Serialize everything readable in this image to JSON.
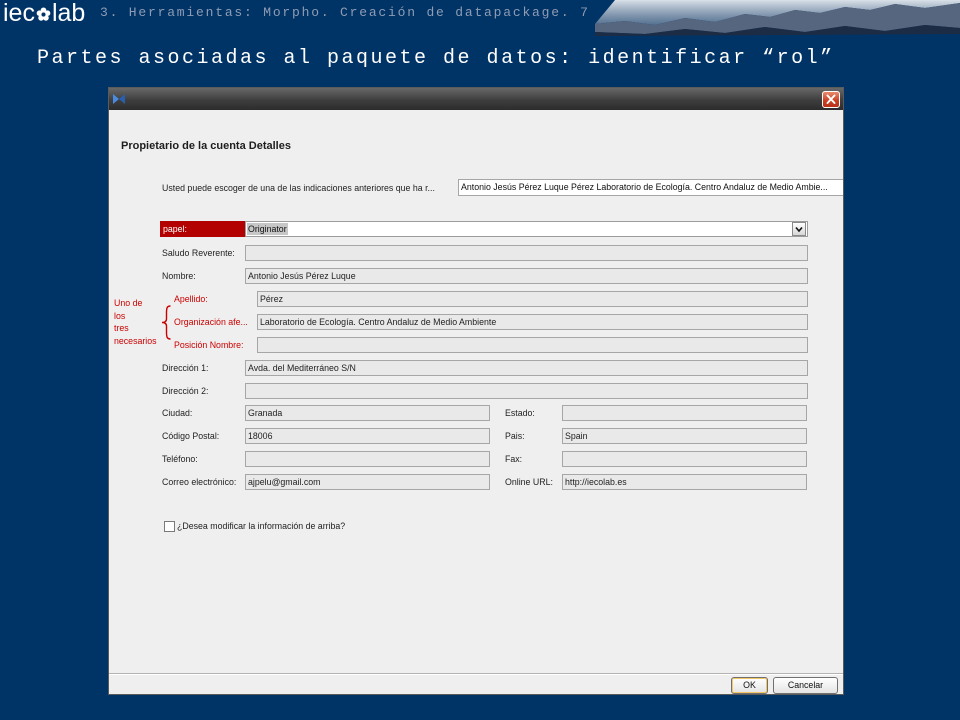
{
  "header": {
    "logo": {
      "part1": "iec",
      "part2": "lab"
    },
    "breadcrumb": "3. Herramientas: Morpho. Creación de datapackage. 7"
  },
  "slide": {
    "title": "Partes asociadas al paquete de datos: identificar “rol”"
  },
  "annotation": {
    "lines": [
      "Uno de",
      "los",
      "tres",
      "necesarios"
    ]
  },
  "dialog": {
    "section_title": "Propietario de la cuenta Detalles",
    "previous_choice": {
      "label": "Usted puede escoger de una de las indicaciones anteriores que ha r...",
      "value": "Antonio Jesús Pérez Luque Pérez Laboratorio de Ecología. Centro Andaluz de Medio Ambie..."
    },
    "role": {
      "label": "papel:",
      "value": "Originator"
    },
    "fields": {
      "salutation": {
        "label": "Saludo Reverente:",
        "value": ""
      },
      "name": {
        "label": "Nombre:",
        "value": "Antonio Jesús Pérez Luque"
      },
      "surname": {
        "label": "Apellido:",
        "value": "Pérez"
      },
      "organization": {
        "label": "Organización afe...",
        "value": "Laboratorio de Ecología. Centro Andaluz de Medio Ambiente"
      },
      "position": {
        "label": "Posición Nombre:",
        "value": ""
      },
      "address1": {
        "label": "Dirección 1:",
        "value": "Avda. del Mediterráneo S/N"
      },
      "address2": {
        "label": "Dirección 2:",
        "value": ""
      },
      "city": {
        "label": "Ciudad:",
        "value": "Granada"
      },
      "state": {
        "label": "Estado:",
        "value": ""
      },
      "postal_code": {
        "label": "Código Postal:",
        "value": "18006"
      },
      "country": {
        "label": "Pais:",
        "value": "Spain"
      },
      "phone": {
        "label": "Teléfono:",
        "value": ""
      },
      "fax": {
        "label": "Fax:",
        "value": ""
      },
      "email": {
        "label": "Correo electrónico:",
        "value": "ajpelu@gmail.com"
      },
      "url": {
        "label": "Online URL:",
        "value": "http://iecolab.es"
      }
    },
    "modify_checkbox": {
      "label": "¿Desea modificar la información de arriba?",
      "checked": false
    },
    "buttons": {
      "ok": "OK",
      "cancel": "Cancelar"
    }
  },
  "icons": {
    "logo": "flower-logo-icon",
    "app": "morpho-butterfly-icon",
    "close": "close-icon",
    "combo_arrow": "chevron-down-icon"
  },
  "colors": {
    "slide_background": "#003366",
    "breadcrumb_text": "#8f9cb3",
    "slide_title_text": "#ffffff",
    "role_label_background": "#b30000",
    "required_label_text": "#cc0000",
    "annotation_text": "#cc0000",
    "dialog_background": "#efefef"
  }
}
